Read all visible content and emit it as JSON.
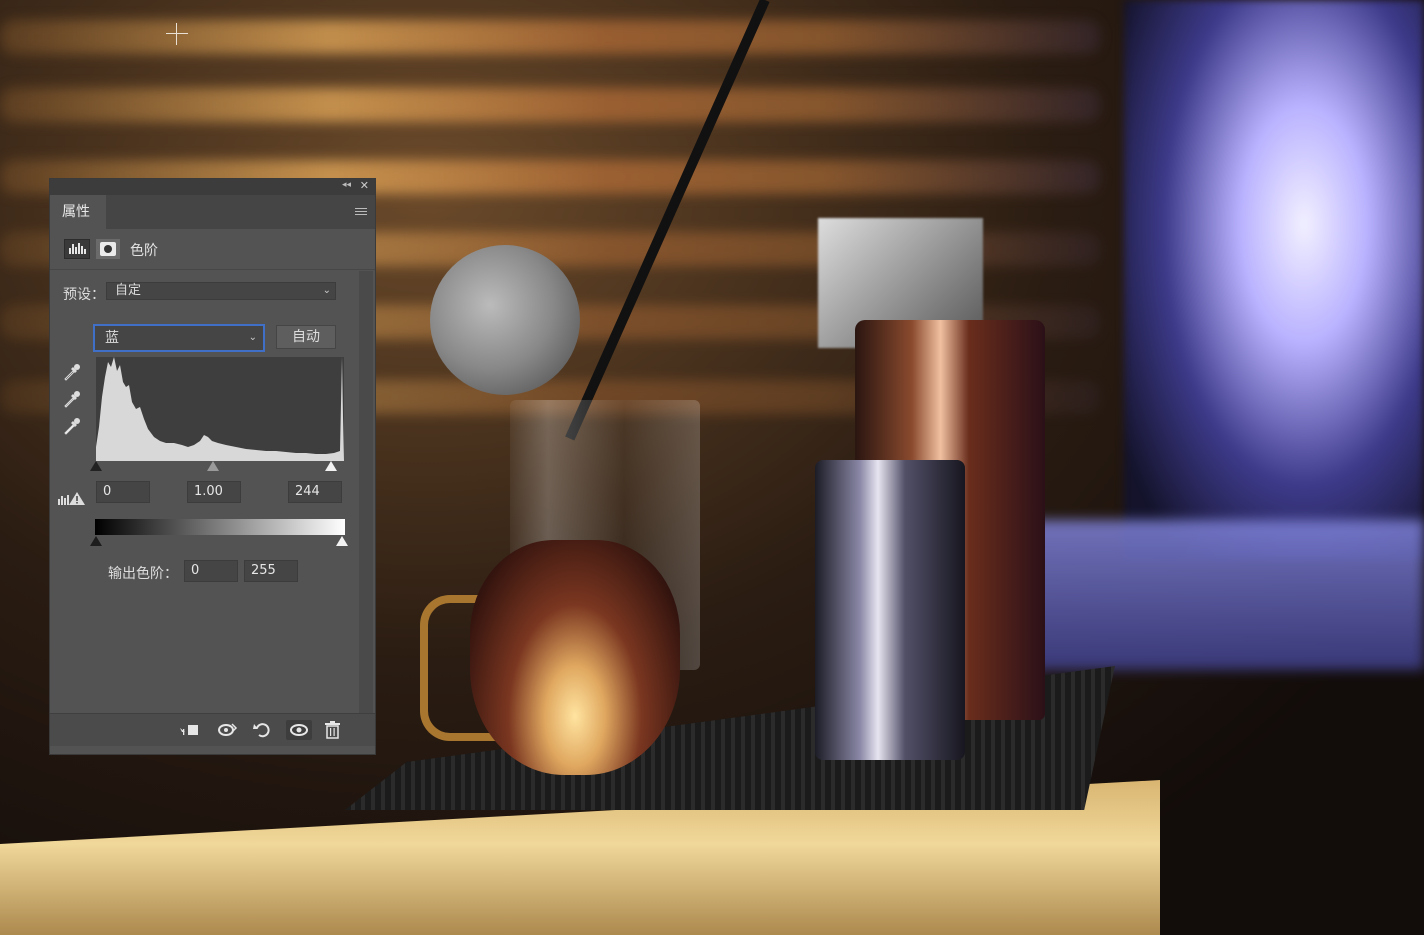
{
  "panel": {
    "tab_label": "属性",
    "adjustment_type_label": "色阶",
    "preset_label": "预设：",
    "preset_value": "自定",
    "channel_value": "蓝",
    "auto_button_label": "自动",
    "input_levels": {
      "black": "0",
      "gamma": "1.00",
      "white": "244"
    },
    "output_label": "输出色阶：",
    "output_levels": {
      "black": "0",
      "white": "255"
    }
  },
  "icons": {
    "collapse": "double-chevron-left-icon",
    "close": "close-icon",
    "panel_menu": "hamburger-menu-icon",
    "levels": "levels-histogram-icon",
    "mask": "layer-mask-icon",
    "eyedropper_black": "black-point-eyedropper-icon",
    "eyedropper_gray": "gray-point-eyedropper-icon",
    "eyedropper_white": "white-point-eyedropper-icon",
    "clip_warning": "clipping-warning-icon",
    "clip_to_layer": "clip-to-layer-icon",
    "view_previous": "view-previous-state-icon",
    "reset": "reset-icon",
    "visibility": "eye-icon",
    "delete": "trash-icon"
  },
  "colors": {
    "panel_bg": "#535353",
    "focus_outline": "#3f6fc6"
  }
}
